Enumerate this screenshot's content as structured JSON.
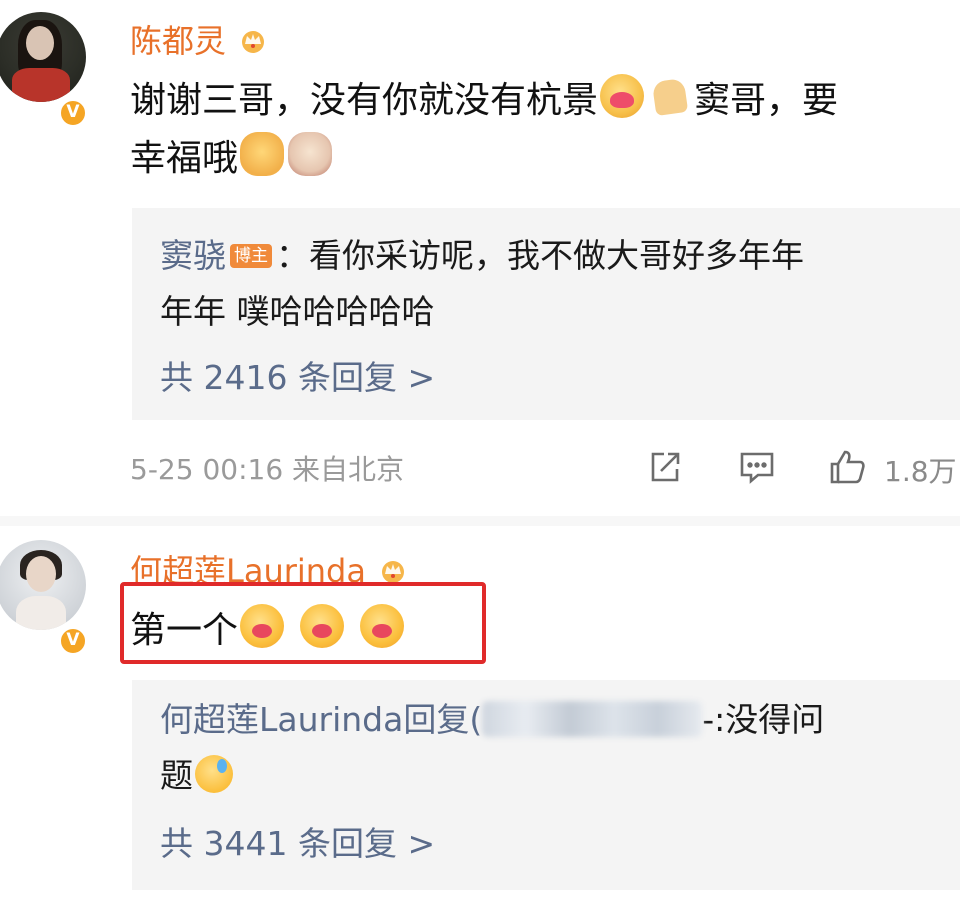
{
  "comments": [
    {
      "author": "陈都灵",
      "text_line1": "谢谢三哥，没有你就没有杭景",
      "text_line1_tail": "窦哥，要",
      "text_line2": "幸福哦",
      "reply": {
        "author": "窦骁",
        "author_tag": "博主",
        "text_line1": "：看你采访呢，我不做大哥好多年年",
        "text_line2": "年年 噗哈哈哈哈哈",
        "reply_count": "共 2416 条回复 >"
      },
      "meta": "5-25 00:16 来自北京",
      "like_count": "1.8万"
    },
    {
      "author": "何超莲Laurinda",
      "text": "第一个",
      "highlighted": true,
      "reply": {
        "text_prefix": "何超莲Laurinda回复",
        "text_suffix": "-:没得问",
        "text_line2": "题",
        "reply_count": "共 3441 条回复 >"
      }
    }
  ],
  "icons": {
    "verified": "verified-v-icon",
    "crown": "crown-icon",
    "share": "share-icon",
    "comment": "comment-icon",
    "like": "like-icon"
  },
  "colors": {
    "author_name": "#e8712a",
    "reply_name": "#5a6b8a",
    "highlight_border": "#e02a2a",
    "verified_badge": "#f5a524",
    "blogger_tag": "#f08a3a"
  }
}
